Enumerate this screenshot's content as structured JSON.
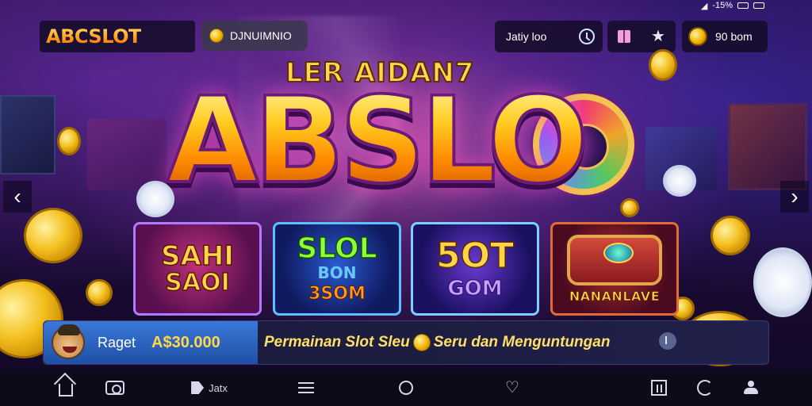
{
  "status_bar": {
    "signal": "◢",
    "battery_text": "-15%"
  },
  "header": {
    "logo": "ABCSLOT",
    "balance_label": "DJNUIMNIO",
    "user_label": "Jatiy loo",
    "coins_label": "90 bom"
  },
  "hero": {
    "subtitle": "LER AIDAN7",
    "title": "ABSLO"
  },
  "games": [
    {
      "line1": "SAHI",
      "line2": "SAOI"
    },
    {
      "line1": "SLOL",
      "line2": "BON",
      "line3": "3SOM"
    },
    {
      "line1": "5OT",
      "line2": "GOM"
    },
    {
      "line1": "NANANLAVE"
    }
  ],
  "promo": {
    "label": "Raget",
    "amount": "A$30.000",
    "text_before": "Permainan Slot Sleu",
    "text_after": "Seru dan Menguntungan"
  },
  "bottom_nav": {
    "tab2_label": "Jatx"
  },
  "colors": {
    "accent_gold": "#ffd84a",
    "promo_blue": "#2f64c4",
    "bg_purple": "#2a0f4a"
  }
}
